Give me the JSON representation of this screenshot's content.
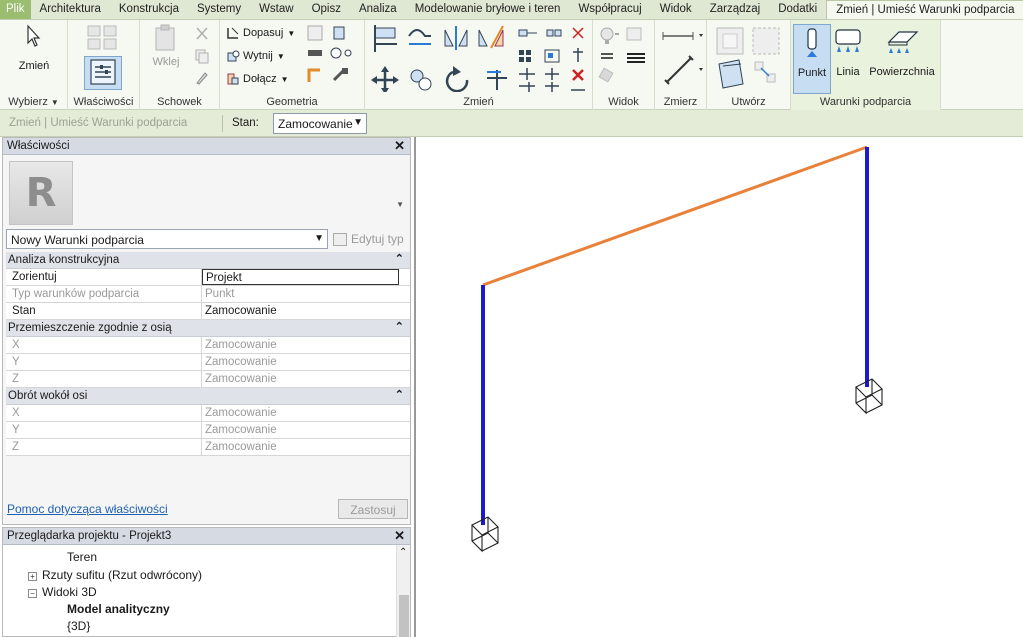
{
  "menu": {
    "file": "Plik",
    "tabs": [
      "Architektura",
      "Konstrukcja",
      "Systemy",
      "Wstaw",
      "Opisz",
      "Analiza",
      "Modelowanie bryłowe i teren",
      "Współpracuj",
      "Widok",
      "Zarządzaj",
      "Dodatki"
    ],
    "active_tab": "Zmień | Umieść Warunki podparcia"
  },
  "ribbon": {
    "modify_label": "Zmień",
    "select_label": "Wybierz",
    "properties_label": "Właściwości",
    "clipboard": {
      "paste_label": "Wklej",
      "panel_label": "Schowek"
    },
    "geometry": {
      "cope": "Dopasuj",
      "cut": "Wytnij",
      "join": "Dołącz",
      "panel_label": "Geometria"
    },
    "modify_panel_label": "Zmień",
    "view_panel_label": "Widok",
    "measure_panel_label": "Zmierz",
    "create_panel_label": "Utwórz",
    "boundary": {
      "panel_label": "Warunki podparcia",
      "point": "Punkt",
      "line": "Linia",
      "area": "Powierzchnia"
    }
  },
  "options_bar": {
    "context": "Zmień | Umieść Warunki podparcia",
    "state_label": "Stan:",
    "state_value": "Zamocowanie"
  },
  "properties": {
    "title": "Właściwości",
    "close": "✕",
    "type_name": "Nowy Warunki podparcia",
    "edit_type": "Edytuj typ",
    "groups": [
      {
        "name": "Analiza konstrukcyjna",
        "rows": [
          {
            "key": "Zorientuj",
            "value": "Projekt",
            "dim": false
          },
          {
            "key": "Typ warunków podparcia",
            "value": "Punkt",
            "dim": true
          },
          {
            "key": "Stan",
            "value": "Zamocowanie",
            "dim": false
          }
        ]
      },
      {
        "name": "Przemieszczenie zgodnie z osią",
        "rows": [
          {
            "key": "X",
            "value": "Zamocowanie",
            "dim": true
          },
          {
            "key": "Y",
            "value": "Zamocowanie",
            "dim": true
          },
          {
            "key": "Z",
            "value": "Zamocowanie",
            "dim": true
          }
        ]
      },
      {
        "name": "Obrót wokół osi",
        "rows": [
          {
            "key": "X",
            "value": "Zamocowanie",
            "dim": true
          },
          {
            "key": "Y",
            "value": "Zamocowanie",
            "dim": true
          },
          {
            "key": "Z",
            "value": "Zamocowanie",
            "dim": true
          }
        ]
      }
    ],
    "help_link": "Pomoc dotycząca właściwości",
    "apply": "Zastosuj"
  },
  "browser": {
    "title": "Przeglądarka projektu - Projekt3",
    "close": "✕",
    "items": {
      "teren": "Teren",
      "ceiling": "Rzuty sufitu (Rzut odwrócony)",
      "views3d": "Widoki 3D",
      "analytical": "Model analityczny",
      "default3d": "{3D}"
    }
  },
  "colors": {
    "beam": "#e8823a",
    "column": "#1a1ad0",
    "accent": "#9bbd6f"
  }
}
